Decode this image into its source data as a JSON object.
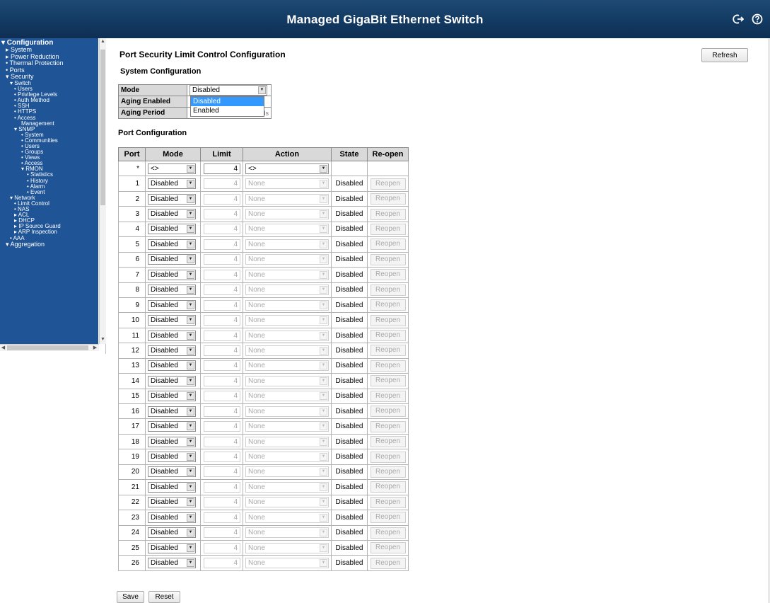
{
  "header": {
    "title": "Managed GigaBit Ethernet Switch",
    "icons": [
      "logout-icon",
      "help-icon"
    ]
  },
  "sidebar": {
    "items": [
      {
        "label": "▾ Configuration",
        "level": 0
      },
      {
        "label": "▸ System",
        "level": 1
      },
      {
        "label": "▸ Power Reduction",
        "level": 1
      },
      {
        "label": "• Thermal Protection",
        "level": 1
      },
      {
        "label": "• Ports",
        "level": 1
      },
      {
        "label": "▾ Security",
        "level": 1
      },
      {
        "label": "▾ Switch",
        "level": 2
      },
      {
        "label": "• Users",
        "level": 3
      },
      {
        "label": "• Privilege Levels",
        "level": 3
      },
      {
        "label": "• Auth Method",
        "level": 3
      },
      {
        "label": "• SSH",
        "level": 3
      },
      {
        "label": "• HTTPS",
        "level": 3
      },
      {
        "label": "• Access",
        "level": 3
      },
      {
        "label": "Management",
        "level": 4
      },
      {
        "label": "▾ SNMP",
        "level": 3
      },
      {
        "label": "• System",
        "level": 4
      },
      {
        "label": "• Communities",
        "level": 4
      },
      {
        "label": "• Users",
        "level": 4
      },
      {
        "label": "• Groups",
        "level": 4
      },
      {
        "label": "• Views",
        "level": 4
      },
      {
        "label": "• Access",
        "level": 4
      },
      {
        "label": "▾ RMON",
        "level": 4
      },
      {
        "label": "• Statistics",
        "level": 5
      },
      {
        "label": "• History",
        "level": 5
      },
      {
        "label": "• Alarm",
        "level": 5
      },
      {
        "label": "• Event",
        "level": 5
      },
      {
        "label": "▾ Network",
        "level": 2
      },
      {
        "label": "• Limit Control",
        "level": 3
      },
      {
        "label": "• NAS",
        "level": 3
      },
      {
        "label": "▸ ACL",
        "level": 3
      },
      {
        "label": "▸ DHCP",
        "level": 3
      },
      {
        "label": "▸ IP Source Guard",
        "level": 3
      },
      {
        "label": "▸ ARP Inspection",
        "level": 3
      },
      {
        "label": "• AAA",
        "level": 2
      },
      {
        "label": "▾ Aggregation",
        "level": 1
      }
    ]
  },
  "main": {
    "page_title": "Port Security Limit Control Configuration",
    "refresh_label": "Refresh",
    "system_heading": "System Configuration",
    "system": {
      "mode_label": "Mode",
      "mode_value": "Disabled",
      "aging_enabled_label": "Aging Enabled",
      "aging_period_label": "Aging Period",
      "aging_period_unit": "seconds",
      "dropdown_options": [
        "Disabled",
        "Enabled"
      ],
      "dropdown_selected": "Disabled"
    },
    "port_heading": "Port Configuration",
    "columns": [
      "Port",
      "Mode",
      "Limit",
      "Action",
      "State",
      "Re-open"
    ],
    "wildcard_row": {
      "port": "*",
      "mode": "<>",
      "limit": "4",
      "action": "<>"
    },
    "rows": [
      {
        "port": "1",
        "mode": "Disabled",
        "limit": "4",
        "action": "None",
        "state": "Disabled",
        "reopen": "Reopen"
      },
      {
        "port": "2",
        "mode": "Disabled",
        "limit": "4",
        "action": "None",
        "state": "Disabled",
        "reopen": "Reopen"
      },
      {
        "port": "3",
        "mode": "Disabled",
        "limit": "4",
        "action": "None",
        "state": "Disabled",
        "reopen": "Reopen"
      },
      {
        "port": "4",
        "mode": "Disabled",
        "limit": "4",
        "action": "None",
        "state": "Disabled",
        "reopen": "Reopen"
      },
      {
        "port": "5",
        "mode": "Disabled",
        "limit": "4",
        "action": "None",
        "state": "Disabled",
        "reopen": "Reopen"
      },
      {
        "port": "6",
        "mode": "Disabled",
        "limit": "4",
        "action": "None",
        "state": "Disabled",
        "reopen": "Reopen"
      },
      {
        "port": "7",
        "mode": "Disabled",
        "limit": "4",
        "action": "None",
        "state": "Disabled",
        "reopen": "Reopen"
      },
      {
        "port": "8",
        "mode": "Disabled",
        "limit": "4",
        "action": "None",
        "state": "Disabled",
        "reopen": "Reopen"
      },
      {
        "port": "9",
        "mode": "Disabled",
        "limit": "4",
        "action": "None",
        "state": "Disabled",
        "reopen": "Reopen"
      },
      {
        "port": "10",
        "mode": "Disabled",
        "limit": "4",
        "action": "None",
        "state": "Disabled",
        "reopen": "Reopen"
      },
      {
        "port": "11",
        "mode": "Disabled",
        "limit": "4",
        "action": "None",
        "state": "Disabled",
        "reopen": "Reopen"
      },
      {
        "port": "12",
        "mode": "Disabled",
        "limit": "4",
        "action": "None",
        "state": "Disabled",
        "reopen": "Reopen"
      },
      {
        "port": "13",
        "mode": "Disabled",
        "limit": "4",
        "action": "None",
        "state": "Disabled",
        "reopen": "Reopen"
      },
      {
        "port": "14",
        "mode": "Disabled",
        "limit": "4",
        "action": "None",
        "state": "Disabled",
        "reopen": "Reopen"
      },
      {
        "port": "15",
        "mode": "Disabled",
        "limit": "4",
        "action": "None",
        "state": "Disabled",
        "reopen": "Reopen"
      },
      {
        "port": "16",
        "mode": "Disabled",
        "limit": "4",
        "action": "None",
        "state": "Disabled",
        "reopen": "Reopen"
      },
      {
        "port": "17",
        "mode": "Disabled",
        "limit": "4",
        "action": "None",
        "state": "Disabled",
        "reopen": "Reopen"
      },
      {
        "port": "18",
        "mode": "Disabled",
        "limit": "4",
        "action": "None",
        "state": "Disabled",
        "reopen": "Reopen"
      },
      {
        "port": "19",
        "mode": "Disabled",
        "limit": "4",
        "action": "None",
        "state": "Disabled",
        "reopen": "Reopen"
      },
      {
        "port": "20",
        "mode": "Disabled",
        "limit": "4",
        "action": "None",
        "state": "Disabled",
        "reopen": "Reopen"
      },
      {
        "port": "21",
        "mode": "Disabled",
        "limit": "4",
        "action": "None",
        "state": "Disabled",
        "reopen": "Reopen"
      },
      {
        "port": "22",
        "mode": "Disabled",
        "limit": "4",
        "action": "None",
        "state": "Disabled",
        "reopen": "Reopen"
      },
      {
        "port": "23",
        "mode": "Disabled",
        "limit": "4",
        "action": "None",
        "state": "Disabled",
        "reopen": "Reopen"
      },
      {
        "port": "24",
        "mode": "Disabled",
        "limit": "4",
        "action": "None",
        "state": "Disabled",
        "reopen": "Reopen"
      },
      {
        "port": "25",
        "mode": "Disabled",
        "limit": "4",
        "action": "None",
        "state": "Disabled",
        "reopen": "Reopen"
      },
      {
        "port": "26",
        "mode": "Disabled",
        "limit": "4",
        "action": "None",
        "state": "Disabled",
        "reopen": "Reopen"
      }
    ],
    "save_label": "Save",
    "reset_label": "Reset"
  },
  "colors": {
    "header_bg": "#123a63",
    "sidebar_bg": "#1f5596",
    "dropdown_highlight": "#3399ff",
    "table_header_bg": "#d9d9d9"
  }
}
